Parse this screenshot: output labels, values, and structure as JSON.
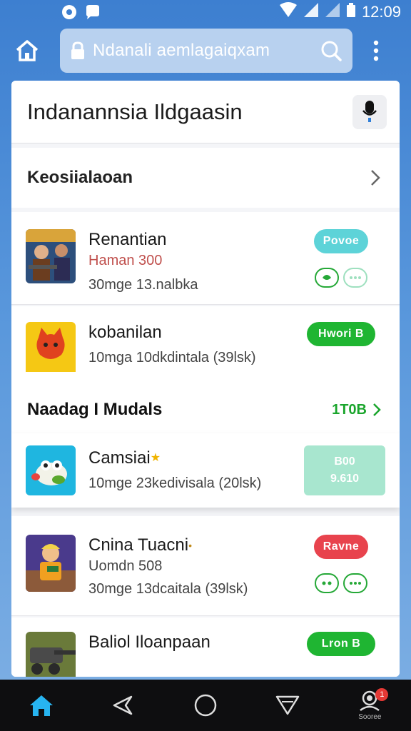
{
  "status_bar": {
    "time": "12:09"
  },
  "browser": {
    "url": "Ndanali aemlagaiqxam"
  },
  "page": {
    "title": "Indanannsia Ildgaasin"
  },
  "section": {
    "label": "Keosiialaoan"
  },
  "apps": [
    {
      "name": "Renantian",
      "line1": "Haman 300",
      "line2": "30mge 13.nalbka",
      "button": "Povoe"
    },
    {
      "name": "kobanilan",
      "line1": "10mga 10dkdintala (39lsk)",
      "button": "Hwori B"
    }
  ],
  "featured": {
    "heading": "Naadag I Mudals",
    "see_all": "1T0B",
    "app": {
      "name": "Camsiai",
      "line1": "10mge 23kedivisala (20lsk)",
      "price_top": "B00",
      "price_bottom": "9.610"
    }
  },
  "apps_lower": [
    {
      "name": "Cnina Tuacni",
      "line1": "Uomdn 508",
      "line2": "30mge 13dcaitala (39lsk)",
      "button": "Ravne"
    },
    {
      "name": "Baliol Iloanpaan",
      "button": "Lron B"
    }
  ],
  "nav": {
    "profile_label": "Sooree",
    "badge_count": "1"
  },
  "colors": {
    "accent_green": "#1fb532",
    "teal": "#5dd3d8",
    "red": "#e8434d",
    "header_blue": "#3d7fd0"
  }
}
